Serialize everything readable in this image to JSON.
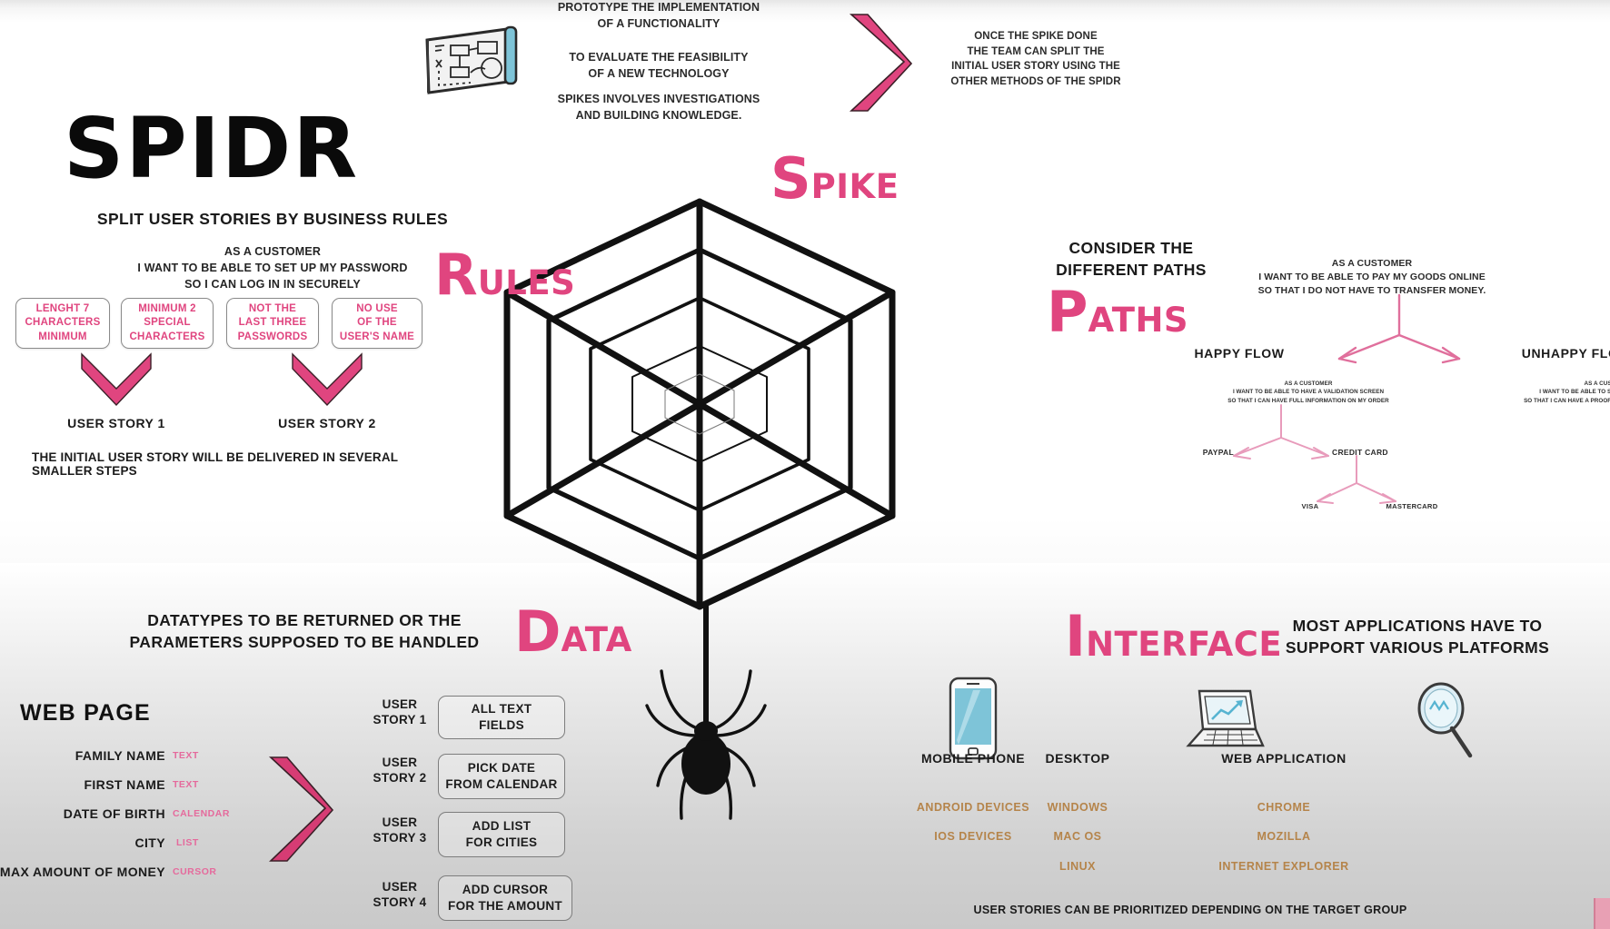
{
  "title": "SPIDR",
  "subtitle_rules": "SPLIT USER STORIES BY BUSINESS RULES",
  "accent_color": "#e0457f",
  "rules": {
    "letter": "R",
    "rest": "ULES",
    "user_story": [
      "AS A CUSTOMER",
      "I WANT TO BE ABLE TO SET UP MY PASSWORD",
      "SO I CAN LOG IN IN SECURELY"
    ],
    "boxes": [
      [
        "LENGHT 7",
        "CHARACTERS",
        "MINIMUM"
      ],
      [
        "MINIMUM 2",
        "SPECIAL",
        "CHARACTERS"
      ],
      [
        "NOT THE",
        "LAST THREE",
        "PASSWORDS"
      ],
      [
        "NO USE",
        "OF THE",
        "USER'S NAME"
      ]
    ],
    "arrow_labels": [
      "USER STORY 1",
      "USER STORY 2"
    ],
    "footnote": "THE INITIAL USER STORY WILL BE DELIVERED IN SEVERAL SMALLER STEPS"
  },
  "spike": {
    "letter": "S",
    "rest": "PIKE",
    "bullets": [
      [
        "PROTOTYPE THE IMPLEMENTATION",
        "OF A FUNCTIONALITY"
      ],
      [
        "TO EVALUATE THE FEASIBILITY",
        "OF A NEW TECHNOLOGY"
      ],
      [
        "SPIKES INVOLVES INVESTIGATIONS",
        "AND BUILDING KNOWLEDGE."
      ]
    ],
    "result": [
      "ONCE THE SPIKE DONE",
      "THE TEAM CAN SPLIT THE",
      "INITIAL USER STORY USING THE",
      "OTHER METHODS OF THE SPIDR"
    ],
    "icon": "whiteboard-icon",
    "arrow": "chevron-right-arrow"
  },
  "paths": {
    "letter": "P",
    "rest": "ATHS",
    "headline": [
      "CONSIDER THE",
      "DIFFERENT PATHS"
    ],
    "root_story": [
      "AS A CUSTOMER",
      "I WANT TO BE ABLE TO PAY MY GOODS ONLINE",
      "SO THAT I DO NOT HAVE TO TRANSFER MONEY."
    ],
    "happy_label": "HAPPY FLOW",
    "unhappy_label": "UNHAPPY FLOW",
    "happy_story": [
      "AS A CUSTOMER",
      "I WANT TO BE ABLE TO HAVE A VALIDATION SCREEN",
      "SO THAT I CAN HAVE FULL INFORMATION ON MY ORDER"
    ],
    "unhappy_story": [
      "AS A CUSTOMER",
      "I WANT TO BE ABLE TO SEE AN ERROR SCREEN",
      "SO THAT I CAN HAVE A PROOF IF MY ACCOUNT IS DEBITED"
    ],
    "payment_left": "PAYPAL",
    "payment_right": "CREDIT CARD",
    "card_left": "VISA",
    "card_right": "MASTERCARD"
  },
  "data": {
    "letter": "D",
    "rest": "ATA",
    "headline": [
      "DATATYPES TO BE RETURNED OR THE",
      "PARAMETERS SUPPOSED TO BE HANDLED"
    ],
    "webpage_title": "WEB PAGE",
    "fields": [
      {
        "name": "FAMILY NAME",
        "type": "TEXT"
      },
      {
        "name": "FIRST NAME",
        "type": "TEXT"
      },
      {
        "name": "DATE OF BIRTH",
        "type": "CALENDAR"
      },
      {
        "name": "CITY",
        "type": "LIST"
      },
      {
        "name": "MAX AMOUNT OF MONEY",
        "type": "CURSOR"
      }
    ],
    "stories": [
      {
        "label": [
          "USER",
          "STORY 1"
        ],
        "box": [
          "ALL TEXT",
          "FIELDS"
        ]
      },
      {
        "label": [
          "USER",
          "STORY 2"
        ],
        "box": [
          "PICK DATE",
          "FROM CALENDAR"
        ]
      },
      {
        "label": [
          "USER",
          "STORY 3"
        ],
        "box": [
          "ADD LIST",
          "FOR CITIES"
        ]
      },
      {
        "label": [
          "USER",
          "STORY 4"
        ],
        "box": [
          "ADD CURSOR",
          "FOR THE AMOUNT"
        ]
      }
    ],
    "arrow": "chevron-right-arrow"
  },
  "interface": {
    "letter": "I",
    "rest": "NTERFACE",
    "headline": [
      "MOST APPLICATIONS HAVE TO",
      "SUPPORT VARIOUS PLATFORMS"
    ],
    "platforms": [
      {
        "icon": "mobile-phone-icon",
        "name": "MOBILE PHONE",
        "items": [
          "ANDROID DEVICES",
          "IOS DEVICES"
        ]
      },
      {
        "icon": "laptop-icon",
        "name": "DESKTOP",
        "items": [
          "WINDOWS",
          "MAC OS",
          "LINUX"
        ]
      },
      {
        "icon": "magnifier-icon",
        "name": "WEB APPLICATION",
        "items": [
          "CHROME",
          "MOZILLA",
          "INTERNET EXPLORER"
        ]
      }
    ],
    "footnote": "USER STORIES CAN BE PRIORITIZED DEPENDING ON THE TARGET GROUP"
  },
  "center": {
    "web": "hexagonal-spider-web",
    "spider": "spider-icon"
  }
}
